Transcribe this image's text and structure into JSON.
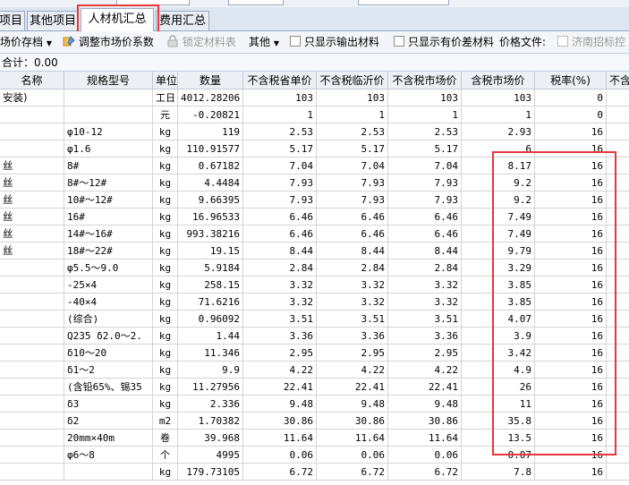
{
  "tabs": [
    {
      "label": "项目",
      "active": false
    },
    {
      "label": "其他项目",
      "active": false
    },
    {
      "label": "人材机汇总",
      "active": true
    },
    {
      "label": "费用汇总",
      "active": false
    }
  ],
  "toolbar": {
    "save_price": "场价存档",
    "adjust_market": "调整市场价系数",
    "lock_material": "锁定材料表",
    "other": "其他",
    "only_output": "只显示输出材料",
    "only_diff": "只显示有价差材料",
    "price_file": "价格文件:",
    "jinan_bid": "济南招标控"
  },
  "summary": {
    "text": "合计：0.00"
  },
  "columns": [
    "名称",
    "规格型号",
    "单位",
    "数量",
    "不含税省单价",
    "不含税临沂价",
    "不含税市场价",
    "含税市场价",
    "税率(%)",
    "不含"
  ],
  "rows": [
    {
      "name": "安装)",
      "spec": "",
      "unit": "工日",
      "qty": "4012.28206",
      "p1": "103",
      "p2": "103",
      "p3": "103",
      "p4": "103",
      "tax": "0"
    },
    {
      "name": "",
      "spec": "",
      "unit": "元",
      "qty": "-0.20821",
      "p1": "1",
      "p2": "1",
      "p3": "1",
      "p4": "1",
      "tax": "0"
    },
    {
      "name": "",
      "spec": "φ10-12",
      "unit": "kg",
      "qty": "119",
      "p1": "2.53",
      "p2": "2.53",
      "p3": "2.53",
      "p4": "2.93",
      "tax": "16"
    },
    {
      "name": "",
      "spec": "φ1.6",
      "unit": "kg",
      "qty": "110.91577",
      "p1": "5.17",
      "p2": "5.17",
      "p3": "5.17",
      "p4": "6",
      "tax": "16"
    },
    {
      "name": "丝",
      "spec": "8#",
      "unit": "kg",
      "qty": "0.67182",
      "p1": "7.04",
      "p2": "7.04",
      "p3": "7.04",
      "p4": "8.17",
      "tax": "16"
    },
    {
      "name": "丝",
      "spec": "8#～12#",
      "unit": "kg",
      "qty": "4.4484",
      "p1": "7.93",
      "p2": "7.93",
      "p3": "7.93",
      "p4": "9.2",
      "tax": "16"
    },
    {
      "name": "丝",
      "spec": "10#～12#",
      "unit": "kg",
      "qty": "9.66395",
      "p1": "7.93",
      "p2": "7.93",
      "p3": "7.93",
      "p4": "9.2",
      "tax": "16"
    },
    {
      "name": "丝",
      "spec": "16#",
      "unit": "kg",
      "qty": "16.96533",
      "p1": "6.46",
      "p2": "6.46",
      "p3": "6.46",
      "p4": "7.49",
      "tax": "16"
    },
    {
      "name": "丝",
      "spec": "14#～16#",
      "unit": "kg",
      "qty": "993.38216",
      "p1": "6.46",
      "p2": "6.46",
      "p3": "6.46",
      "p4": "7.49",
      "tax": "16"
    },
    {
      "name": "丝",
      "spec": "18#～22#",
      "unit": "kg",
      "qty": "19.15",
      "p1": "8.44",
      "p2": "8.44",
      "p3": "8.44",
      "p4": "9.79",
      "tax": "16"
    },
    {
      "name": "",
      "spec": "φ5.5～9.0",
      "unit": "kg",
      "qty": "5.9184",
      "p1": "2.84",
      "p2": "2.84",
      "p3": "2.84",
      "p4": "3.29",
      "tax": "16"
    },
    {
      "name": "",
      "spec": "-25×4",
      "unit": "kg",
      "qty": "258.15",
      "p1": "3.32",
      "p2": "3.32",
      "p3": "3.32",
      "p4": "3.85",
      "tax": "16"
    },
    {
      "name": "",
      "spec": "-40×4",
      "unit": "kg",
      "qty": "71.6216",
      "p1": "3.32",
      "p2": "3.32",
      "p3": "3.32",
      "p4": "3.85",
      "tax": "16"
    },
    {
      "name": "",
      "spec": "(综合)",
      "unit": "kg",
      "qty": "0.96092",
      "p1": "3.51",
      "p2": "3.51",
      "p3": "3.51",
      "p4": "4.07",
      "tax": "16"
    },
    {
      "name": "",
      "spec": "Q235 δ2.0～2.",
      "unit": "kg",
      "qty": "1.44",
      "p1": "3.36",
      "p2": "3.36",
      "p3": "3.36",
      "p4": "3.9",
      "tax": "16"
    },
    {
      "name": "",
      "spec": "δ10～20",
      "unit": "kg",
      "qty": "11.346",
      "p1": "2.95",
      "p2": "2.95",
      "p3": "2.95",
      "p4": "3.42",
      "tax": "16"
    },
    {
      "name": "",
      "spec": "δ1～2",
      "unit": "kg",
      "qty": "9.9",
      "p1": "4.22",
      "p2": "4.22",
      "p3": "4.22",
      "p4": "4.9",
      "tax": "16"
    },
    {
      "name": "",
      "spec": "(含铅65%、锡35",
      "unit": "kg",
      "qty": "11.27956",
      "p1": "22.41",
      "p2": "22.41",
      "p3": "22.41",
      "p4": "26",
      "tax": "16"
    },
    {
      "name": "",
      "spec": "δ3",
      "unit": "kg",
      "qty": "2.336",
      "p1": "9.48",
      "p2": "9.48",
      "p3": "9.48",
      "p4": "11",
      "tax": "16"
    },
    {
      "name": "",
      "spec": "δ2",
      "unit": "m2",
      "qty": "1.70382",
      "p1": "30.86",
      "p2": "30.86",
      "p3": "30.86",
      "p4": "35.8",
      "tax": "16"
    },
    {
      "name": "",
      "spec": "20mm×40m",
      "unit": "卷",
      "qty": "39.968",
      "p1": "11.64",
      "p2": "11.64",
      "p3": "11.64",
      "p4": "13.5",
      "tax": "16"
    },
    {
      "name": "",
      "spec": "φ6～8",
      "unit": "个",
      "qty": "4995",
      "p1": "0.06",
      "p2": "0.06",
      "p3": "0.06",
      "p4": "0.07",
      "tax": "16"
    },
    {
      "name": "",
      "spec": "",
      "unit": "kg",
      "qty": "179.73105",
      "p1": "6.72",
      "p2": "6.72",
      "p3": "6.72",
      "p4": "7.8",
      "tax": "16"
    }
  ],
  "colors": {
    "highlight_border": "#e8363a",
    "header_bg": "#eceff3",
    "tabbar_bg": "#dde6f1"
  }
}
